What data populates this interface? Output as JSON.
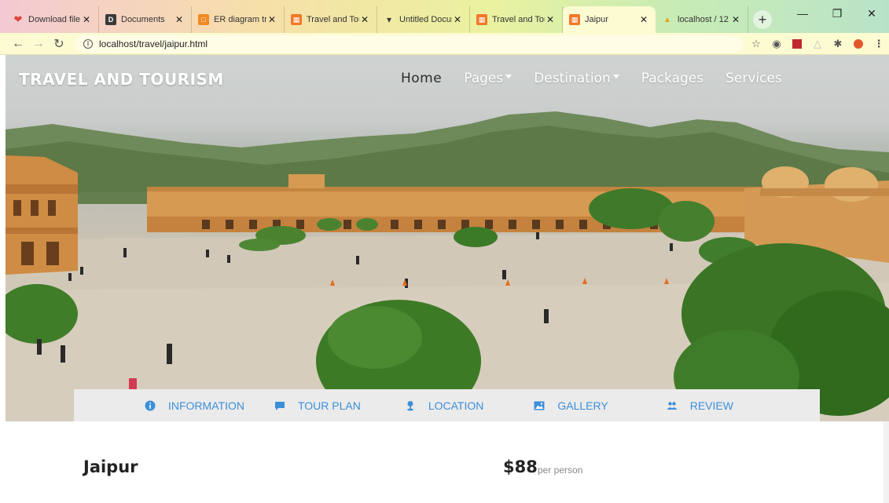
{
  "browser": {
    "tabs": [
      {
        "title": "Download file",
        "icon": "heart-icon",
        "color": "#e0463c",
        "active": false
      },
      {
        "title": "Documents",
        "icon": "document-icon",
        "color": "#3a3a3a",
        "active": false
      },
      {
        "title": "ER diagram tre",
        "icon": "diagram-icon",
        "color": "#f08a24",
        "active": false
      },
      {
        "title": "Travel and Tou",
        "icon": "photo-icon",
        "color": "#f0782a",
        "active": false
      },
      {
        "title": "Untitled Docur",
        "icon": "pin-icon",
        "color": "#3b3b3b",
        "active": false
      },
      {
        "title": "Travel and Tou",
        "icon": "photo-icon",
        "color": "#f0782a",
        "active": false
      },
      {
        "title": "Jaipur",
        "icon": "photo-icon",
        "color": "#f0782a",
        "active": true
      },
      {
        "title": "localhost / 12",
        "icon": "database-icon",
        "color": "#e6a020",
        "active": false
      }
    ],
    "url": "localhost/travel/jaipur.html"
  },
  "site": {
    "brand": "TRAVEL AND TOURISM",
    "nav": {
      "home": "Home",
      "pages": "Pages",
      "destination": "Destination",
      "packages": "Packages",
      "services": "Services"
    },
    "sections": [
      {
        "label": "INFORMATION",
        "icon": "info-icon"
      },
      {
        "label": "TOUR PLAN",
        "icon": "chat-icon"
      },
      {
        "label": "LOCATION",
        "icon": "map-pin-icon"
      },
      {
        "label": "GALLERY",
        "icon": "image-icon"
      },
      {
        "label": "REVIEW",
        "icon": "users-icon"
      }
    ],
    "title": "Jaipur",
    "price": "$88",
    "price_unit": "per person",
    "accent": "#3b8fd8"
  }
}
